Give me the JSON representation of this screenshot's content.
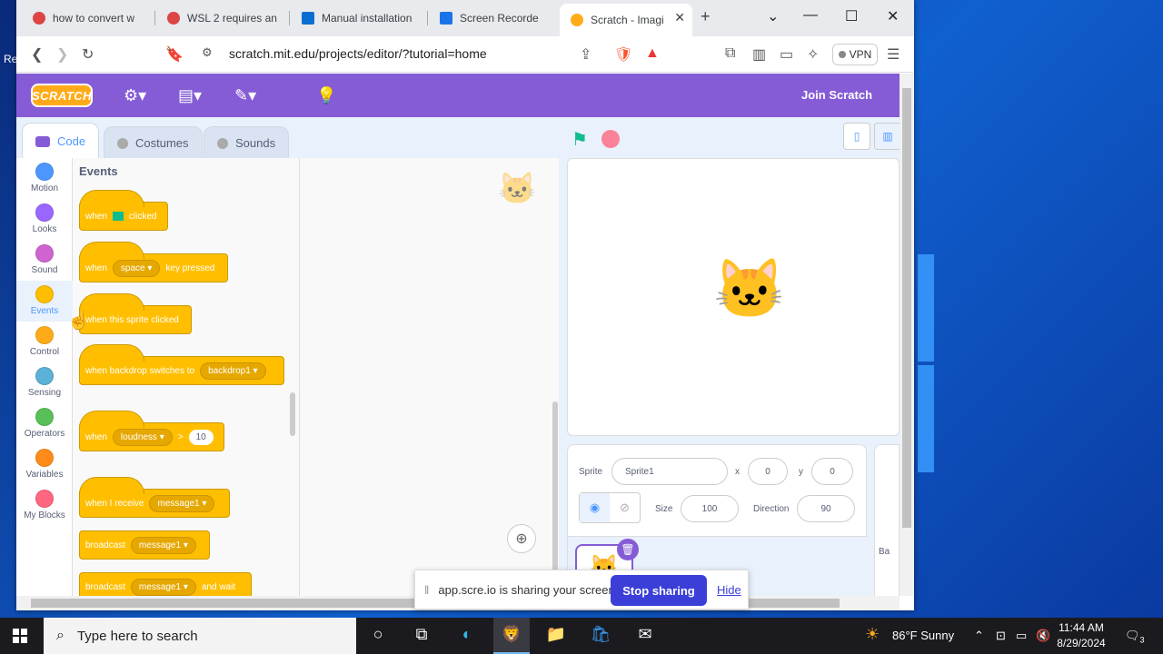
{
  "browser": {
    "tabs": [
      {
        "label": "how to convert w",
        "color": "#d44"
      },
      {
        "label": "WSL 2 requires an",
        "color": "#d44"
      },
      {
        "label": "Manual installation",
        "color": "#0a6ed1"
      },
      {
        "label": "Screen Recorde",
        "color": "#1a73e8"
      },
      {
        "label": "Scratch - Imagi",
        "color": "#ffab19"
      }
    ],
    "new_tab": "+",
    "url": "scratch.mit.edu/projects/editor/?tutorial=home",
    "vpn_label": "VPN"
  },
  "scratch": {
    "logo": "SCRATCH",
    "join_label": "Join Scratch",
    "tabs": {
      "code": "Code",
      "costumes": "Costumes",
      "sounds": "Sounds"
    },
    "categories": [
      {
        "label": "Motion",
        "color": "#4c97ff"
      },
      {
        "label": "Looks",
        "color": "#9966ff"
      },
      {
        "label": "Sound",
        "color": "#cf63cf"
      },
      {
        "label": "Events",
        "color": "#ffbf00"
      },
      {
        "label": "Control",
        "color": "#ffab19"
      },
      {
        "label": "Sensing",
        "color": "#5cb1d6"
      },
      {
        "label": "Operators",
        "color": "#59c059"
      },
      {
        "label": "Variables",
        "color": "#ff8c1a"
      },
      {
        "label": "My Blocks",
        "color": "#ff6680"
      }
    ],
    "palette_title": "Events",
    "blocks": {
      "when": "when",
      "clicked": "clicked",
      "space": "space",
      "key_pressed": "key pressed",
      "sprite_clicked": "when this sprite clicked",
      "backdrop_switches": "when backdrop switches to",
      "backdrop1": "backdrop1",
      "loudness": "loudness",
      "gt": ">",
      "ten": "10",
      "i_receive": "when I receive",
      "message1": "message1",
      "broadcast": "broadcast",
      "and_wait": "and wait"
    },
    "sprite": {
      "label": "Sprite",
      "name": "Sprite1",
      "x_label": "x",
      "x": "0",
      "y_label": "y",
      "y": "0",
      "size_label": "Size",
      "size": "100",
      "direction_label": "Direction",
      "direction": "90",
      "stage_abbrev": "Ba"
    }
  },
  "share_bar": {
    "message": "app.scre.io is sharing your screen.",
    "stop": "Stop sharing",
    "hide": "Hide"
  },
  "taskbar": {
    "search_placeholder": "Type here to search",
    "weather": "86°F  Sunny",
    "time": "11:44 AM",
    "date": "8/29/2024",
    "notif_count": "3"
  },
  "desktop": {
    "label_re": "Re"
  }
}
